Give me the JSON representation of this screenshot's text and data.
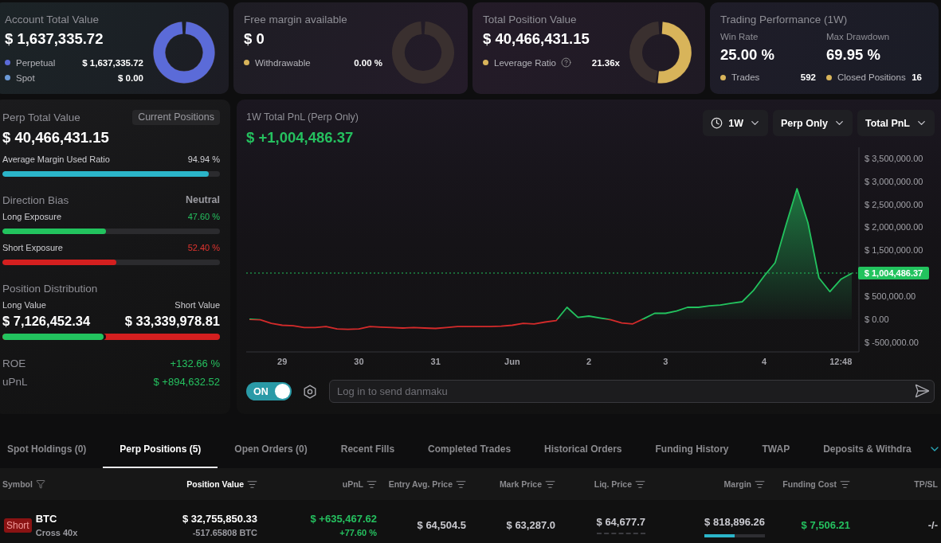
{
  "cards": [
    {
      "kind": "gauge",
      "title": "Account Total Value",
      "value": "$ 1,637,335.72",
      "legend": [
        {
          "label": "Perpetual",
          "value": "$ 1,637,335.72",
          "color": "#5b6bd8",
          "help": false
        },
        {
          "label": "Spot",
          "value": "$ 0.00",
          "color": "#6b9ad8",
          "help": false
        }
      ],
      "ring": {
        "level": 1
      }
    },
    {
      "kind": "gauge",
      "title": "Free margin available",
      "value": "$ 0",
      "legend": [
        {
          "label": "Withdrawable",
          "value": "0.00 %",
          "color": "#d8b45a",
          "help": false
        }
      ]
    },
    {
      "kind": "gauge",
      "title": "Total Position Value",
      "value": "$ 40,466,431.15",
      "legend": [
        {
          "label": "Leverage Ratio",
          "value": "21.36x",
          "color": "#d8b45a",
          "help": true
        }
      ],
      "ring": {
        "level": 0.52
      }
    },
    {
      "kind": "performance",
      "title": "Trading Performance (1W)",
      "stats": [
        {
          "label": "Win Rate",
          "value": "25.00 %"
        },
        {
          "label": "Max Drawdown",
          "value": "69.95 %"
        }
      ],
      "legend": [
        {
          "label": "Trades",
          "value": "592",
          "color": "#d8b45a"
        },
        {
          "label": "Closed Positions",
          "value": "16",
          "color": "#d8b45a"
        }
      ]
    }
  ],
  "perp_panel": {
    "title": "Perp Total Value",
    "badge": "Current Positions",
    "value": "$ 40,466,431.15",
    "margin_ratio": {
      "label": "Average Margin Used Ratio",
      "reading": "94.94 %",
      "level": 0.9494
    },
    "direction_bias": {
      "title": "Direction Bias",
      "verdict": "Neutral",
      "long": {
        "label": "Long Exposure",
        "reading": "47.60 %",
        "level": 0.476
      },
      "short": {
        "label": "Short Exposure",
        "reading": "52.40 %",
        "level": 0.524
      }
    },
    "distribution": {
      "title": "Position Distribution",
      "long_label": "Long Value",
      "short_label": "Short Value",
      "long_value": "$ 7,126,452.34",
      "short_value": "$ 33,339,978.81",
      "level": 0.47
    },
    "stats": [
      {
        "label": "ROE",
        "value": "+132.66 %"
      },
      {
        "label": "uPnL",
        "value": "$ +894,632.52"
      }
    ]
  },
  "pnl_panel": {
    "title": "1W Total PnL (Perp Only)",
    "value": "$ +1,004,486.37",
    "dropdowns": [
      {
        "label": "1W",
        "kind": "period"
      },
      {
        "label": "Perp Only",
        "kind": "market"
      },
      {
        "label": "Total PnL",
        "kind": "metric"
      }
    ],
    "chart_data": {
      "type": "area",
      "categories": [
        null,
        null,
        null,
        "29",
        null,
        null,
        null,
        null,
        null,
        null,
        "30",
        null,
        null,
        null,
        null,
        null,
        null,
        "31",
        null,
        null,
        null,
        null,
        null,
        null,
        "Jun",
        null,
        null,
        null,
        null,
        null,
        null,
        "2",
        null,
        null,
        null,
        null,
        null,
        null,
        "3",
        null,
        null,
        null,
        null,
        null,
        null,
        null,
        null,
        "4",
        null,
        null,
        null,
        null,
        null,
        null,
        "12:48",
        null
      ],
      "series": [
        {
          "color": "#22c35e",
          "values": [
            0,
            -10000,
            -90000,
            -130000,
            -140000,
            -180000,
            -180000,
            -160000,
            -210000,
            -220000,
            -210000,
            -160000,
            -170000,
            -180000,
            -190000,
            -180000,
            -190000,
            -200000,
            -180000,
            -160000,
            -160000,
            -160000,
            -160000,
            -150000,
            -130000,
            -90000,
            -100000,
            -60000,
            -30000,
            260000,
            40000,
            70000,
            30000,
            -10000,
            -80000,
            -100000,
            10000,
            130000,
            130000,
            180000,
            260000,
            260000,
            290000,
            310000,
            350000,
            380000,
            620000,
            940000,
            1230000,
            2050000,
            2840000,
            2100000,
            900000,
            600000,
            870000,
            1000000
          ]
        }
      ],
      "ylim": [
        -710000,
        3740000
      ],
      "yticks": [
        {
          "value": 3500000,
          "label": "$ 3,500,000.00"
        },
        {
          "value": 3000000,
          "label": "$ 3,000,000.00"
        },
        {
          "value": 2500000,
          "label": "$ 2,500,000.00"
        },
        {
          "value": 2000000,
          "label": "$ 2,000,000.00"
        },
        {
          "value": 1500000,
          "label": "$ 1,500,000.00"
        },
        {
          "value": 500000,
          "label": "$ 500,000.00"
        },
        {
          "value": 0,
          "label": "$ 0.00"
        },
        {
          "value": -500000,
          "label": "$ -500,000.00"
        }
      ],
      "ref_lines": [
        {
          "axis": "y",
          "value": 1004486.37,
          "label": "$ 1,004,486.37"
        }
      ]
    },
    "danmaku": {
      "toggle": {
        "label": "ON",
        "on": true
      },
      "placeholder": "Log in to send danmaku"
    }
  },
  "positions": {
    "tabs": [
      {
        "label": "Spot Holdings (0)",
        "selected": false
      },
      {
        "label": "Perp Positions (5)",
        "selected": true
      },
      {
        "label": "Open Orders (0)",
        "selected": false
      },
      {
        "label": "Recent Fills",
        "selected": false
      },
      {
        "label": "Completed Trades",
        "selected": false
      },
      {
        "label": "Historical Orders",
        "selected": false
      },
      {
        "label": "Funding History",
        "selected": false
      },
      {
        "label": "TWAP",
        "selected": false
      },
      {
        "label": "Deposits & Withdra",
        "selected": false
      }
    ],
    "columns": [
      {
        "label": "Symbol",
        "kind": "filter",
        "selected": false
      },
      {
        "label": "Position Value",
        "kind": "sort",
        "selected": true
      },
      {
        "label": "uPnL",
        "kind": "sort",
        "selected": false
      },
      {
        "label": "Entry Avg. Price",
        "kind": "sort",
        "selected": false
      },
      {
        "label": "Mark Price",
        "kind": "sort",
        "selected": false
      },
      {
        "label": "Liq. Price",
        "kind": "sort",
        "selected": false
      },
      {
        "label": "Margin",
        "kind": "sort",
        "selected": false
      },
      {
        "label": "Funding Cost",
        "kind": "sort",
        "selected": false
      },
      {
        "label": "TP/SL",
        "kind": "plain",
        "selected": false
      }
    ],
    "rows": [
      {
        "side": {
          "label": "Short",
          "kind": "short"
        },
        "symbol": "BTC",
        "mode": "Cross 40x",
        "position_value": "$ 32,755,850.33",
        "size": "-517.65808 BTC",
        "upnl": "$ +635,467.62",
        "upnl_percent": "+77.60 %",
        "entry_price": "$ 64,504.5",
        "mark_price": "$ 63,287.0",
        "liq_price": "$ 64,677.7",
        "margin": {
          "value": "$ 818,896.26",
          "level": 0.5
        },
        "funding_cost": "$ 7,506.21",
        "tp_sl": "-/-"
      }
    ]
  }
}
